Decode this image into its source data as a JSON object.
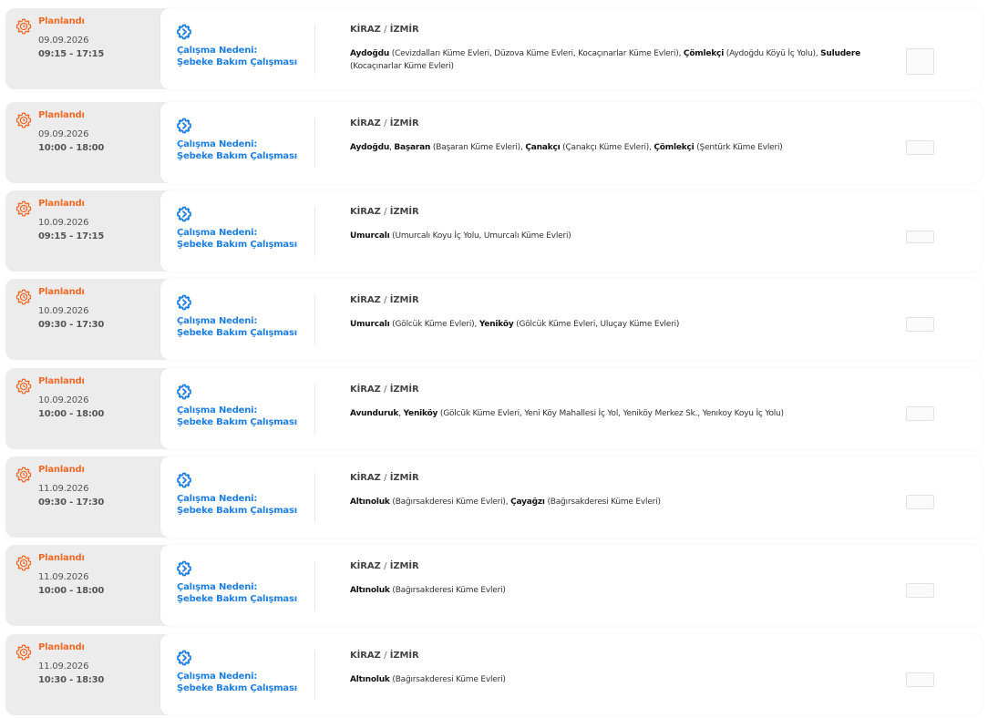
{
  "colors": {
    "status_orange": "#ee6a28",
    "reason_blue": "#1f7fe0",
    "row_bg": "#ececec"
  },
  "icons": {
    "status": "gear-clock-icon",
    "reason": "gear-icon"
  },
  "outages": [
    {
      "status": "Planlandı",
      "date": "09.09.2026",
      "time": "09:15 - 17:15",
      "reason_label": "Çalışma Nedeni:",
      "reason": "Şebeke Bakım Çalışması",
      "district": "KİRAZ",
      "separator": "/",
      "province": "İZMİR",
      "locations": [
        {
          "name": "Aydoğdu",
          "detail": " (Cevizdalları Küme Evleri, Düzova Küme Evleri, Kocaçınarlar Küme Evleri), "
        },
        {
          "name": "Çömlekçi",
          "detail": " (Aydoğdu Köyü İç Yolu), "
        },
        {
          "name": "Suludere",
          "detail": " (Kocaçınarlar Küme Evleri)"
        }
      ]
    },
    {
      "status": "Planlandı",
      "date": "09.09.2026",
      "time": "10:00 - 18:00",
      "reason_label": "Çalışma Nedeni:",
      "reason": "Şebeke Bakım Çalışması",
      "district": "KİRAZ",
      "separator": "/",
      "province": "İZMİR",
      "locations": [
        {
          "name": "Aydoğdu",
          "detail": ", "
        },
        {
          "name": "Başaran",
          "detail": " (Başaran Küme Evleri), "
        },
        {
          "name": "Çanakçı",
          "detail": " (Çanakçı Küme Evleri), "
        },
        {
          "name": "Çömlekçi",
          "detail": " (Şentürk Küme Evleri)"
        }
      ]
    },
    {
      "status": "Planlandı",
      "date": "10.09.2026",
      "time": "09:15 - 17:15",
      "reason_label": "Çalışma Nedeni:",
      "reason": "Şebeke Bakım Çalışması",
      "district": "KİRAZ",
      "separator": "/",
      "province": "İZMİR",
      "locations": [
        {
          "name": "Umurcalı",
          "detail": " (Umurcalı Koyu İç Yolu, Umurcalı Küme Evleri)"
        }
      ]
    },
    {
      "status": "Planlandı",
      "date": "10.09.2026",
      "time": "09:30 - 17:30",
      "reason_label": "Çalışma Nedeni:",
      "reason": "Şebeke Bakım Çalışması",
      "district": "KİRAZ",
      "separator": "/",
      "province": "İZMİR",
      "locations": [
        {
          "name": "Umurcalı",
          "detail": " (Gölcük Küme Evleri), "
        },
        {
          "name": "Yeniköy",
          "detail": " (Gölcük Küme Evleri, Uluçay Küme Evleri)"
        }
      ]
    },
    {
      "status": "Planlandı",
      "date": "10.09.2026",
      "time": "10:00 - 18:00",
      "reason_label": "Çalışma Nedeni:",
      "reason": "Şebeke Bakım Çalışması",
      "district": "KİRAZ",
      "separator": "/",
      "province": "İZMİR",
      "locations": [
        {
          "name": "Avunduruk",
          "detail": ", "
        },
        {
          "name": "Yeniköy",
          "detail": " (Gölcük Küme Evleri, Yeni Köy Mahallesi İç Yol, Yeniköy Merkez Sk., Yenıkoy Koyu İç Yolu)"
        }
      ]
    },
    {
      "status": "Planlandı",
      "date": "11.09.2026",
      "time": "09:30 - 17:30",
      "reason_label": "Çalışma Nedeni:",
      "reason": "Şebeke Bakım Çalışması",
      "district": "KİRAZ",
      "separator": "/",
      "province": "İZMİR",
      "locations": [
        {
          "name": "Altınoluk",
          "detail": " (Bağırsakderesi Küme Evleri), "
        },
        {
          "name": "Çayağzı",
          "detail": " (Bağırsakderesi Küme Evleri)"
        }
      ]
    },
    {
      "status": "Planlandı",
      "date": "11.09.2026",
      "time": "10:00 - 18:00",
      "reason_label": "Çalışma Nedeni:",
      "reason": "Şebeke Bakım Çalışması",
      "district": "KİRAZ",
      "separator": "/",
      "province": "İZMİR",
      "locations": [
        {
          "name": "Altınoluk",
          "detail": " (Bağırsakderesi Küme Evleri)"
        }
      ]
    },
    {
      "status": "Planlandı",
      "date": "11.09.2026",
      "time": "10:30 - 18:30",
      "reason_label": "Çalışma Nedeni:",
      "reason": "Şebeke Bakım Çalışması",
      "district": "KİRAZ",
      "separator": "/",
      "province": "İZMİR",
      "locations": [
        {
          "name": "Altınoluk",
          "detail": " (Bağırsakderesi Küme Evleri)"
        }
      ]
    }
  ]
}
